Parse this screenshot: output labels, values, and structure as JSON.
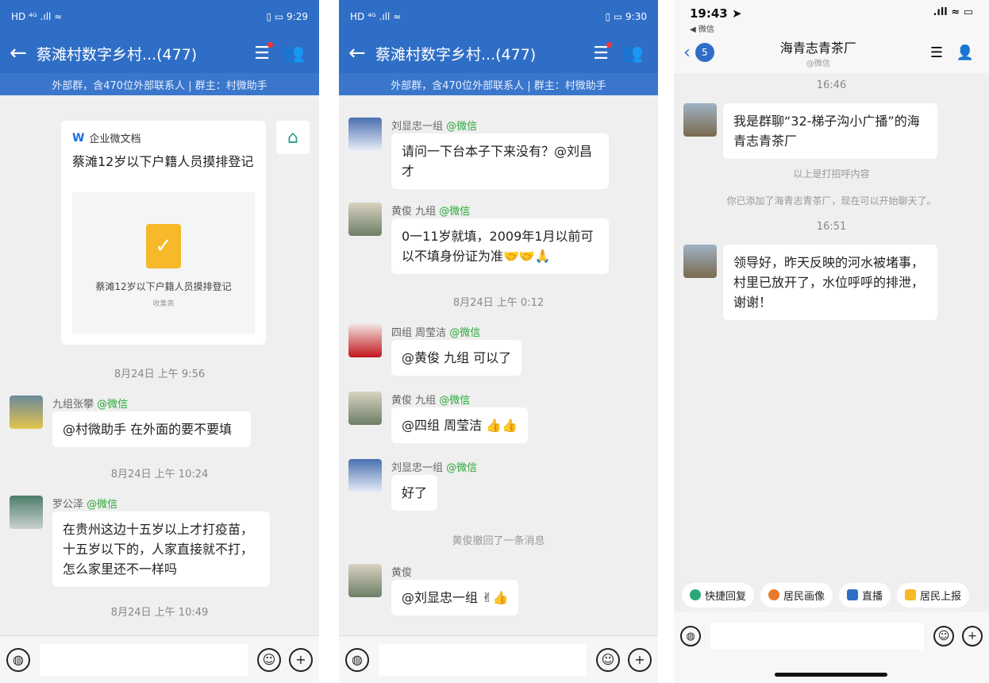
{
  "phone1": {
    "status": {
      "left": "HD ⁴ᴳ .ıll ≈",
      "right": "▯ ▭ 9:29"
    },
    "title": "蔡滩村数字乡村...(477)",
    "subbar": "外部群，含470位外部联系人 | 群主：村微助手",
    "doc": {
      "brand": "企业微文档",
      "title": "蔡滩12岁以下户籍人员摸排登记",
      "preview_title": "蔡滩12岁以下户籍人员摸排登记",
      "preview_sub": "收集表"
    },
    "times": [
      "8月24日  上午 9:56",
      "8月24日  上午 10:24",
      "8月24日  上午 10:49"
    ],
    "messages": [
      {
        "sender": "九组张攀",
        "tag": "@微信",
        "text": "@村微助手 在外面的要不要填"
      },
      {
        "sender": "罗公泽",
        "tag": "@微信",
        "text": "在贵州这边十五岁以上才打疫苗，十五岁以下的，人家直接就不打，怎么家里还不一样吗"
      }
    ]
  },
  "phone2": {
    "status": {
      "left": "HD ⁴ᴳ .ıll ≈",
      "right": "▯ ▭ 9:30"
    },
    "title": "蔡滩村数字乡村...(477)",
    "subbar": "外部群，含470位外部联系人 | 群主：村微助手",
    "times": [
      "8月24日  上午 0:12"
    ],
    "recall": "黄俊撤回了一条消息",
    "messages": [
      {
        "sender": "刘显忠一组",
        "tag": "@微信",
        "text": "请问一下台本子下来没有？@刘昌才"
      },
      {
        "sender": "黄俊 九组",
        "tag": "@微信",
        "text": "0一11岁就填，2009年1月以前可以不填身份证为准🤝🤝🙏"
      },
      {
        "sender": "四组 周莹洁",
        "tag": "@微信",
        "text": "@黄俊 九组 可以了"
      },
      {
        "sender": "黄俊 九组",
        "tag": "@微信",
        "text": "@四组 周莹洁 👍👍"
      },
      {
        "sender": "刘显忠一组",
        "tag": "@微信",
        "text": "好了"
      },
      {
        "sender": "黄俊",
        "tag": "",
        "text": "@刘显忠一组 ✌👍"
      }
    ]
  },
  "phone3": {
    "status": {
      "time": "19:43 ➤",
      "back_app": "◀ 微信"
    },
    "unread": "5",
    "title": "海青志青茶厂",
    "subtitle": "@微信",
    "times": [
      "16:46",
      "16:51"
    ],
    "notes": [
      "以上是打招呼内容",
      "你已添加了海青志青茶厂，现在可以开始聊天了。"
    ],
    "messages": [
      {
        "text": "我是群聊“32-梯子沟小广播”的海青志青茶厂"
      },
      {
        "text": "领导好，昨天反映的河水被堵事，村里已放开了，水位呼呼的排泄，谢谢！"
      }
    ],
    "quick_replies": [
      "快捷回复",
      "居民画像",
      "直播",
      "居民上报"
    ]
  },
  "colors": {
    "header_blue": "#2f6ec6",
    "wechat_tag": "#2aa839",
    "doc_yellow": "#f5b929"
  }
}
